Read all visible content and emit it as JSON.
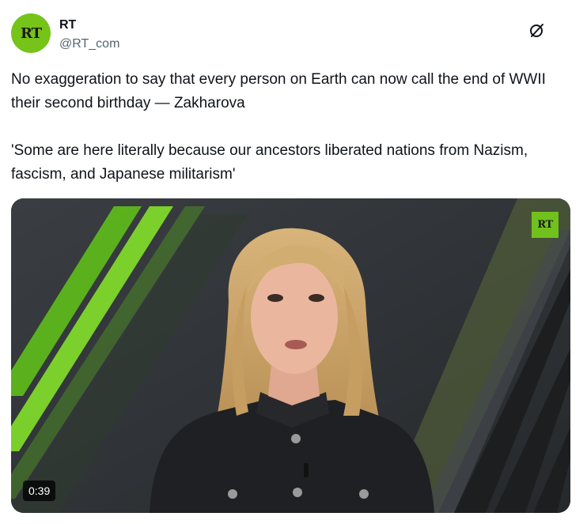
{
  "account": {
    "display_name": "RT",
    "handle": "@RT_com",
    "avatar_text": "RT",
    "avatar_color": "#76c31a"
  },
  "header": {
    "grok_icon": "grok-icon"
  },
  "tweet": {
    "paragraph_1": "No exaggeration to say that every person on Earth can now call the end of WWII their second birthday — Zakharova",
    "paragraph_2": "'Some are here literally because our ancestors liberated nations from Nazism, fascism, and Japanese militarism'"
  },
  "video": {
    "duration": "0:39",
    "channel_logo": "RT",
    "accent_color": "#70c11c"
  }
}
